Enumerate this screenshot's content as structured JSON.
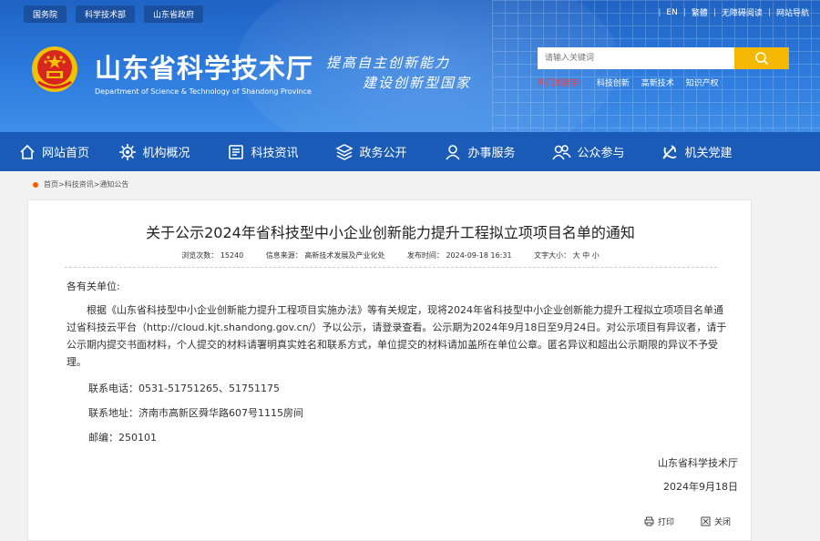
{
  "top_links": [
    "国务院",
    "科学技术部",
    "山东省政府"
  ],
  "utility": [
    "EN",
    "繁體",
    "无障碍阅读",
    "网站导航"
  ],
  "site": {
    "title": "山东省科学技术厅",
    "subtitle": "Department of Science & Technology of Shandong Province",
    "slogan_line1": "提高自主创新能力",
    "slogan_line2": "建设创新型国家"
  },
  "search": {
    "placeholder": "请输入关键词",
    "hot_label": "热门关键字：",
    "hot_keywords": [
      "科技创新",
      "高新技术",
      "知识产权"
    ]
  },
  "nav": [
    {
      "label": "网站首页",
      "icon": "home-icon"
    },
    {
      "label": "机构概况",
      "icon": "gear-icon"
    },
    {
      "label": "科技资讯",
      "icon": "newspaper-icon"
    },
    {
      "label": "政务公开",
      "icon": "layers-icon"
    },
    {
      "label": "办事服务",
      "icon": "user-icon"
    },
    {
      "label": "公众参与",
      "icon": "people-icon"
    },
    {
      "label": "机关党建",
      "icon": "party-emblem-icon"
    }
  ],
  "breadcrumb": "首页>科技资讯>通知公告",
  "article": {
    "title": "关于公示2024年省科技型中小企业创新能力提升工程拟立项项目名单的通知",
    "meta": {
      "views": "浏览次数： 15240",
      "source": "信息来源： 高新技术发展及产业化处",
      "date": "发布时间： 2024-09-18 16:31",
      "font_size": "文字大小： 大 中 小"
    },
    "salutation": "各有关单位:",
    "body_lines": [
      "　　根据《山东省科技型中小企业创新能力提升工程项目实施办法》等有关规定，现将2024年省科技型中小企业创新能力提升工程拟立项项目名单通",
      "过省科技云平台（http://cloud.kjt.shandong.gov.cn/）予以公示，请登录查看。公示期为2024年9月18日至9月24日。对公示项目有异议者，请于",
      "公示期内提交书面材料，个人提交的材料请署明真实姓名和联系方式，单位提交的材料请加盖所在单位公章。匿名异议和超出公示期限的异议不予受",
      "理。"
    ],
    "phone": "联系电话：0531-51751265、51751175",
    "address": "联系地址：济南市高新区舜华路607号1115房间",
    "postcode": "邮编：250101",
    "signer": "山东省科学技术厅",
    "sign_date": "2024年9月18日",
    "print_label": "打印",
    "close_label": "关闭"
  },
  "colors": {
    "header_blue": "#2c7bde",
    "nav_blue": "#1b5bb8",
    "search_button": "#f5b800",
    "hot_label": "#ff3b3b",
    "breadcrumb_dot": "#ff5a00"
  }
}
